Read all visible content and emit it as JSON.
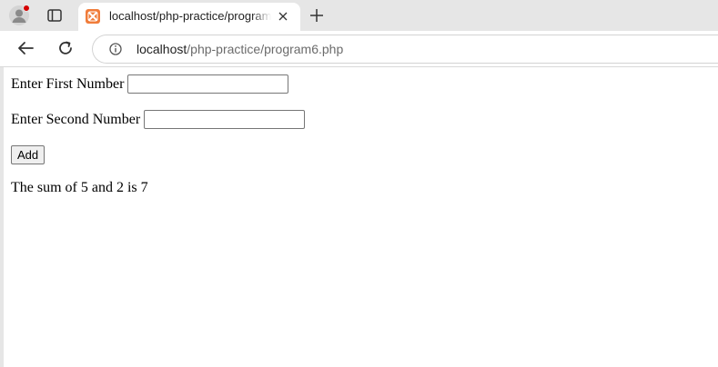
{
  "browser": {
    "tab": {
      "title": "localhost/php-practice/program6.php",
      "favicon": "xampp-icon",
      "close_icon": "close-icon"
    },
    "new_tab_icon": "plus-icon",
    "profile_icon": "profile-avatar-icon",
    "profile_badge_color": "#d50000",
    "tab_search_icon": "tab-search-icon",
    "back_icon": "back-arrow-icon",
    "reload_icon": "reload-icon",
    "site_info_icon": "info-icon",
    "address": {
      "host": "localhost",
      "path": "/php-practice/program6.php"
    }
  },
  "page": {
    "first_label": "Enter First Number",
    "first_value": "",
    "second_label": "Enter Second Number",
    "second_value": "",
    "add_label": "Add",
    "result": "The sum of 5 and 2 is 7"
  }
}
